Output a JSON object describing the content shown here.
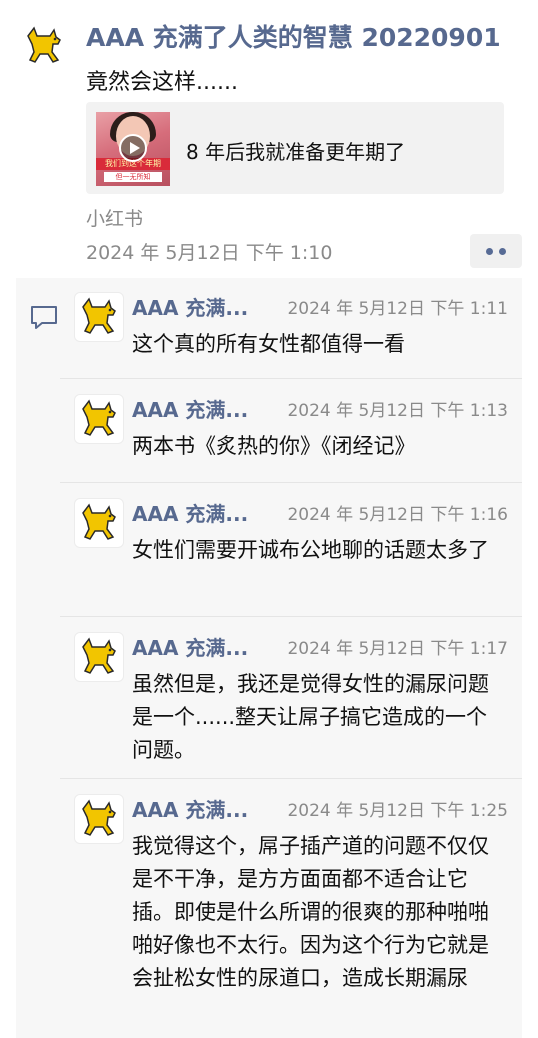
{
  "post": {
    "author": "AAA 充满了人类的智慧 20220901",
    "text": "竟然会这样......",
    "share": {
      "title": "8 年后我就准备更年期了",
      "thumb_caption_1": "我们到这个年期",
      "thumb_caption_2": "但一无所知"
    },
    "source": "小红书",
    "time": "2024 年 5月12日 下午 1:10",
    "avatar_icon": "yellow-dog-icon"
  },
  "comments": [
    {
      "name": "AAA 充满...",
      "time": "2024 年 5月12日 下午 1:11",
      "text": "这个真的所有女性都值得一看"
    },
    {
      "name": "AAA 充满...",
      "time": "2024 年 5月12日 下午 1:13",
      "text": "两本书《炙热的你》《闭经记》"
    },
    {
      "name": "AAA 充满...",
      "time": "2024 年 5月12日 下午 1:16",
      "text": "女性们需要开诚布公地聊的话题太多了"
    },
    {
      "name": "AAA 充满...",
      "time": "2024 年 5月12日 下午 1:17",
      "text": "虽然但是，我还是觉得女性的漏尿问题是一个......整天让屌子搞它造成的一个问题。"
    },
    {
      "name": "AAA 充满...",
      "time": "2024 年 5月12日 下午 1:25",
      "text": "我觉得这个，屌子插产道的问题不仅仅是不干净，是方方面面都不适合让它插。即使是什么所谓的很爽的那种啪啪啪好像也不太行。因为这个行为它就是会扯松女性的尿道口，造成长期漏尿"
    }
  ],
  "colors": {
    "name": "#57698f",
    "panel": "#f7f7f7",
    "meta": "#8a8a8a"
  }
}
